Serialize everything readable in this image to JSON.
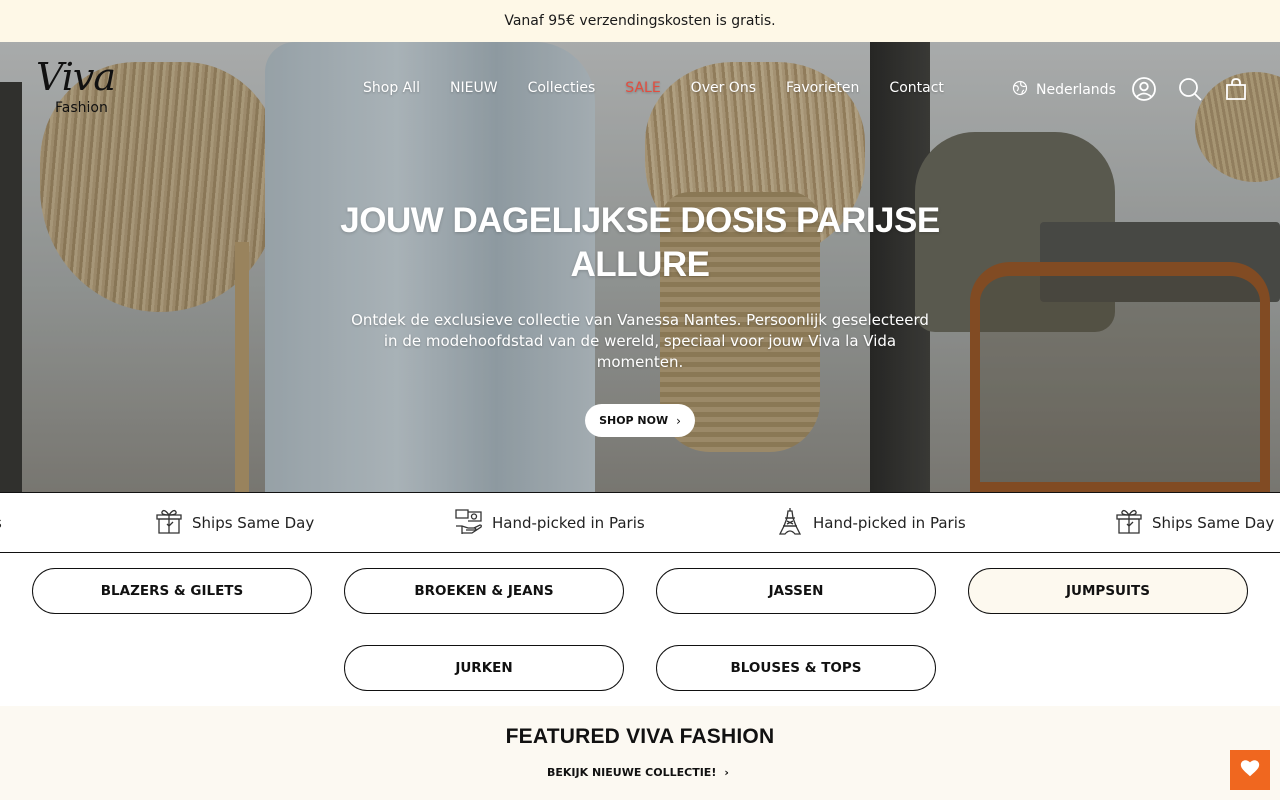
{
  "announcement": {
    "text": "Vanaf 95€ verzendingskosten is gratis."
  },
  "header": {
    "logo": {
      "word": "Viva",
      "sub": "Fashion"
    },
    "nav": [
      "Shop All",
      "NIEUW",
      "Collecties",
      "SALE",
      "Over Ons",
      "Favorieten",
      "Contact"
    ],
    "language": "Nederlands",
    "icons": [
      "globe-icon",
      "account-icon",
      "search-icon",
      "cart-icon"
    ]
  },
  "hero": {
    "title": "JOUW DAGELIJKSE DOSIS PARIJSE ALLURE",
    "subtitle": "Ontdek de exclusieve collectie van Vanessa Nantes. Persoonlijk geselecteerd in de modehoofdstad van de wereld, speciaal voor jouw Viva la Vida momenten.",
    "cta": "SHOP NOW"
  },
  "ticker": [
    {
      "label": "s",
      "icon": ""
    },
    {
      "label": "Ships Same Day",
      "icon": "gift-box-icon"
    },
    {
      "label": "Hand-picked in Paris",
      "icon": "hand-money-icon"
    },
    {
      "label": "Hand-picked in Paris",
      "icon": "eiffel-tower-icon"
    },
    {
      "label": "Ships Same Day",
      "icon": "gift-box-icon"
    }
  ],
  "categories": [
    "BLAZERS & GILETS",
    "BROEKEN & JEANS",
    "JASSEN",
    "JUMPSUITS",
    "JURKEN",
    "BLOUSES & TOPS"
  ],
  "featured": {
    "title": "FEATURED VIVA FASHION",
    "link": "BEKIJK NIEUWE COLLECTIE!"
  },
  "colors": {
    "sale": "#e24d3f",
    "announce_bg": "#fef8e7",
    "fab": "#f0671f"
  }
}
